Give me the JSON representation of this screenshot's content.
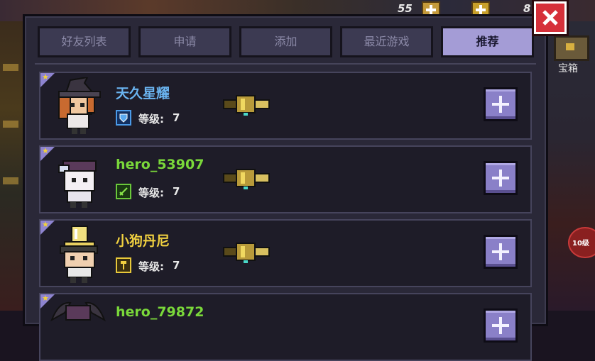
{
  "top_bar": {
    "count_left": "55",
    "count_right": "8"
  },
  "side": {
    "chest_label": "宝箱",
    "level_badge": "10级"
  },
  "tabs": [
    {
      "label": "好友列表",
      "active": false
    },
    {
      "label": "申请",
      "active": false
    },
    {
      "label": "添加",
      "active": false
    },
    {
      "label": "最近游戏",
      "active": false
    },
    {
      "label": "推荐",
      "active": true
    }
  ],
  "friends": [
    {
      "name": "天久星耀",
      "name_color": "#6ab4f0",
      "level_label": "等级:",
      "level": "7",
      "class_icon": "shield-icon",
      "class_color": "#4a9ae8"
    },
    {
      "name": "hero_53907",
      "name_color": "#7ad83a",
      "level_label": "等级:",
      "level": "7",
      "class_icon": "sword-icon",
      "class_color": "#6ac83a"
    },
    {
      "name": "小狗丹尼",
      "name_color": "#f0d040",
      "level_label": "等级:",
      "level": "7",
      "class_icon": "staff-icon",
      "class_color": "#e8c83a"
    },
    {
      "name": "hero_79872",
      "name_color": "#7ad83a",
      "level_label": "",
      "level": "",
      "class_icon": "",
      "class_color": ""
    }
  ],
  "colors": {
    "accent": "#a49cd6",
    "panel": "#2a2838",
    "close": "#d6303a"
  }
}
